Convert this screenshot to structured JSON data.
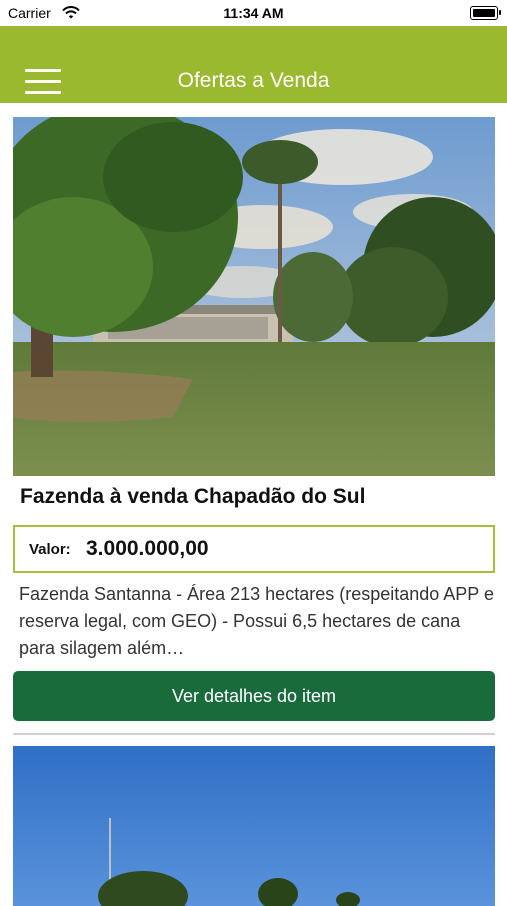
{
  "status_bar": {
    "carrier": "Carrier",
    "time": "11:34 AM",
    "battery_level": 1.0
  },
  "nav": {
    "title": "Ofertas a Venda",
    "menu_icon": "hamburger-menu-icon"
  },
  "colors": {
    "nav_background": "#9bb92f",
    "price_border": "#a5bf3a",
    "button_background": "#1a6b3c"
  },
  "listings": [
    {
      "title": "Fazenda à venda Chapadão do Sul",
      "price_label": "Valor:",
      "price_value": "3.000.000,00",
      "description": "Fazenda Santanna - Área 213 hectares (respeitando APP e reserva legal, com GEO) - Possui 6,5 hectares de cana para silagem além…",
      "button_label": "Ver detalhes do item"
    }
  ]
}
